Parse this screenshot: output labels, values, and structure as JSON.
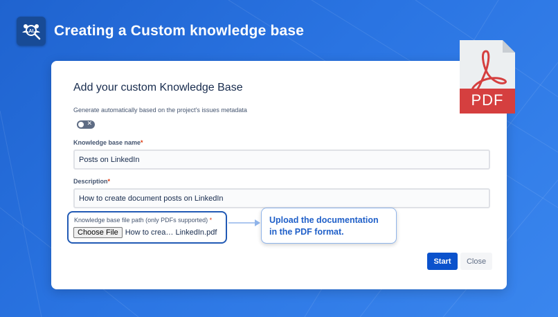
{
  "banner": {
    "title": "Creating a Custom knowledge base",
    "logo_icon": "ai-team-search-icon"
  },
  "pdf_badge": {
    "label": "PDF",
    "icon": "pdf-document-icon",
    "color": "#d53f3f"
  },
  "dialog": {
    "title": "Add your custom Knowledge Base",
    "auto_generate": {
      "label": "Generate automatically based on the project's issues metadata",
      "enabled": false
    },
    "kb_name": {
      "label": "Knowledge base name",
      "required_mark": "*",
      "value": "Posts on LinkedIn"
    },
    "description": {
      "label": "Description",
      "required_mark": "*",
      "value": "How to create document posts on LinkedIn"
    },
    "file": {
      "label": "Knowledge base file path (only PDFs supported)",
      "required_mark": "*",
      "button_label": "Choose File",
      "file_name": "How to crea… LinkedIn.pdf"
    },
    "start_label": "Start",
    "close_label": "Close"
  },
  "callout": {
    "line1": "Upload the documentation",
    "line2": "in the PDF format."
  },
  "colors": {
    "primary": "#0b52cc",
    "callout_text": "#1f5fc8",
    "background": "#2a74e2"
  }
}
